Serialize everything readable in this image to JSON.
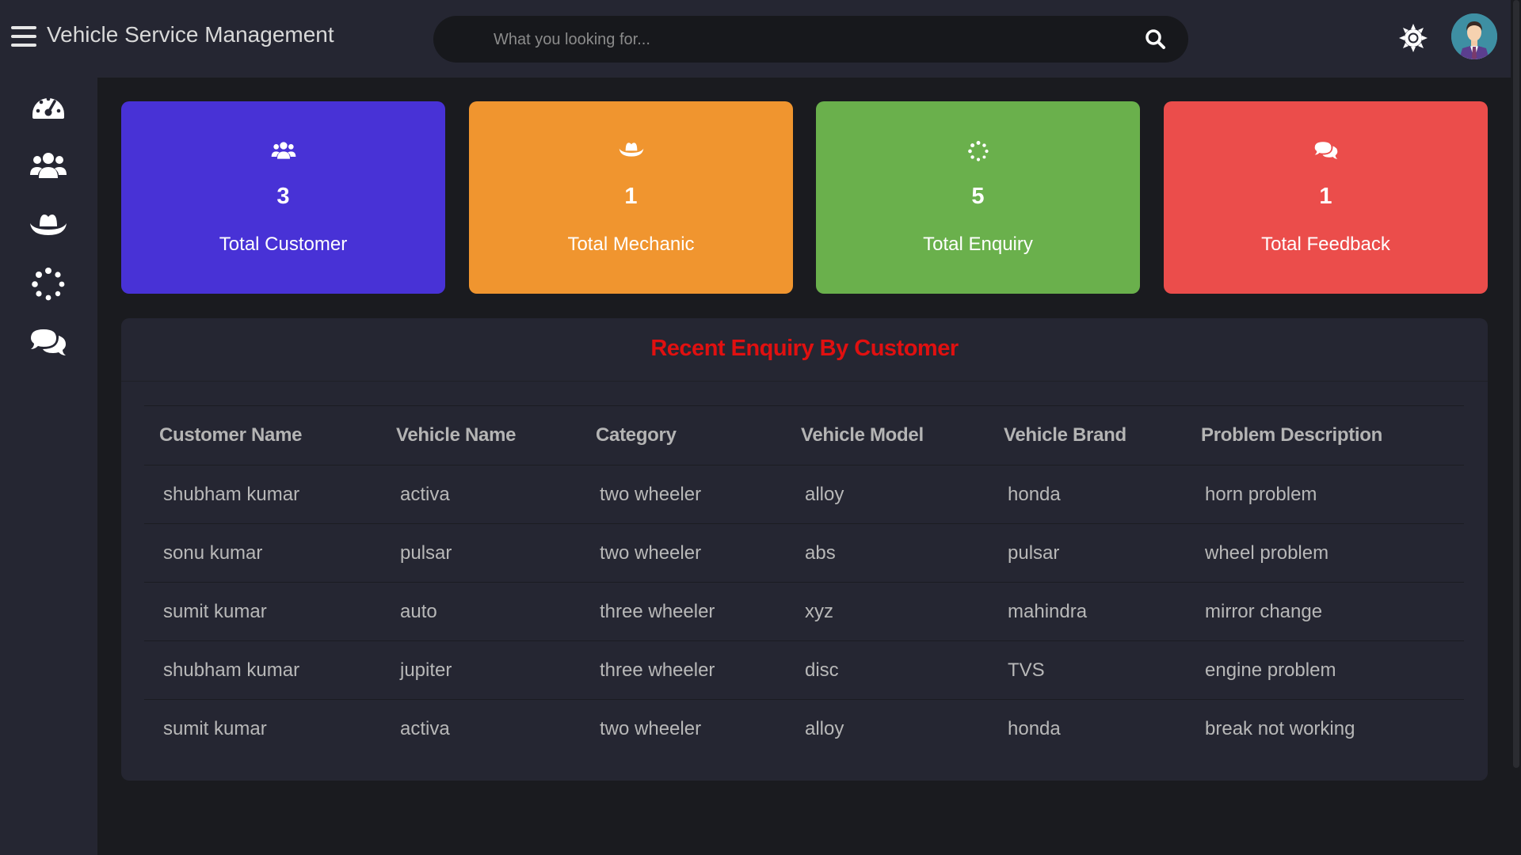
{
  "header": {
    "title": "Vehicle Service Management",
    "search_placeholder": "What you looking for..."
  },
  "sidebar": {
    "items": [
      {
        "icon": "dashboard-icon"
      },
      {
        "icon": "users-icon"
      },
      {
        "icon": "mechanic-hat-icon"
      },
      {
        "icon": "spinner-icon"
      },
      {
        "icon": "comments-icon"
      }
    ]
  },
  "cards": [
    {
      "icon": "users-icon",
      "value": "3",
      "label": "Total Customer",
      "color": "#4832d6"
    },
    {
      "icon": "mechanic-hat-icon",
      "value": "1",
      "label": "Total Mechanic",
      "color": "#f0952f"
    },
    {
      "icon": "spinner-icon",
      "value": "5",
      "label": "Total Enquiry",
      "color": "#6ab04c"
    },
    {
      "icon": "comments-icon",
      "value": "1",
      "label": "Total Feedback",
      "color": "#eb4d4b"
    }
  ],
  "enquiry_table": {
    "title": "Recent Enquiry By Customer",
    "title_color": "#e01010",
    "columns": [
      "Customer Name",
      "Vehicle Name",
      "Category",
      "Vehicle Model",
      "Vehicle Brand",
      "Problem Description"
    ],
    "rows": [
      [
        "shubham kumar",
        "activa",
        "two wheeler",
        "alloy",
        "honda",
        "horn problem"
      ],
      [
        "sonu kumar",
        "pulsar",
        "two wheeler",
        "abs",
        "pulsar",
        "wheel problem"
      ],
      [
        "sumit kumar",
        "auto",
        "three wheeler",
        "xyz",
        "mahindra",
        "mirror change"
      ],
      [
        "shubham kumar",
        "jupiter",
        "three wheeler",
        "disc",
        "TVS",
        "engine problem"
      ],
      [
        "sumit kumar",
        "activa",
        "two wheeler",
        "alloy",
        "honda",
        "break not working"
      ]
    ]
  }
}
